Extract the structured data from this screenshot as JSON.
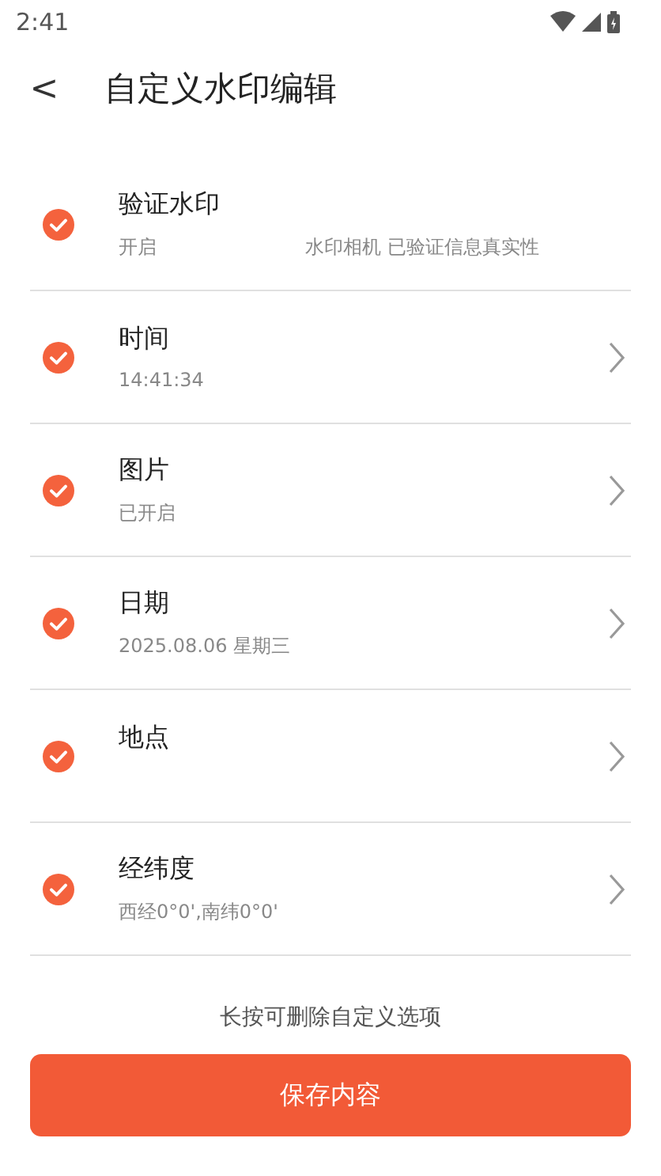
{
  "status_bar": {
    "time": "2:41"
  },
  "header": {
    "back": "<",
    "title": "自定义水印编辑"
  },
  "items": [
    {
      "kind": "info",
      "checked": true,
      "title": "验证水印",
      "subtitle": "开启",
      "note": "水印相机 已验证信息真实性"
    },
    {
      "kind": "nav",
      "checked": true,
      "title": "时间",
      "subtitle": "14:41:34"
    },
    {
      "kind": "nav",
      "checked": true,
      "title": "图片",
      "subtitle": "已开启"
    },
    {
      "kind": "nav",
      "checked": true,
      "title": "日期",
      "subtitle": "2025.08.06 星期三"
    },
    {
      "kind": "nav",
      "checked": true,
      "title": "地点"
    },
    {
      "kind": "nav",
      "checked": true,
      "title": "经纬度",
      "subtitle": "西经0°0',南纬0°0'"
    }
  ],
  "hint": "长按可删除自定义选项",
  "save_button": "保存内容"
}
